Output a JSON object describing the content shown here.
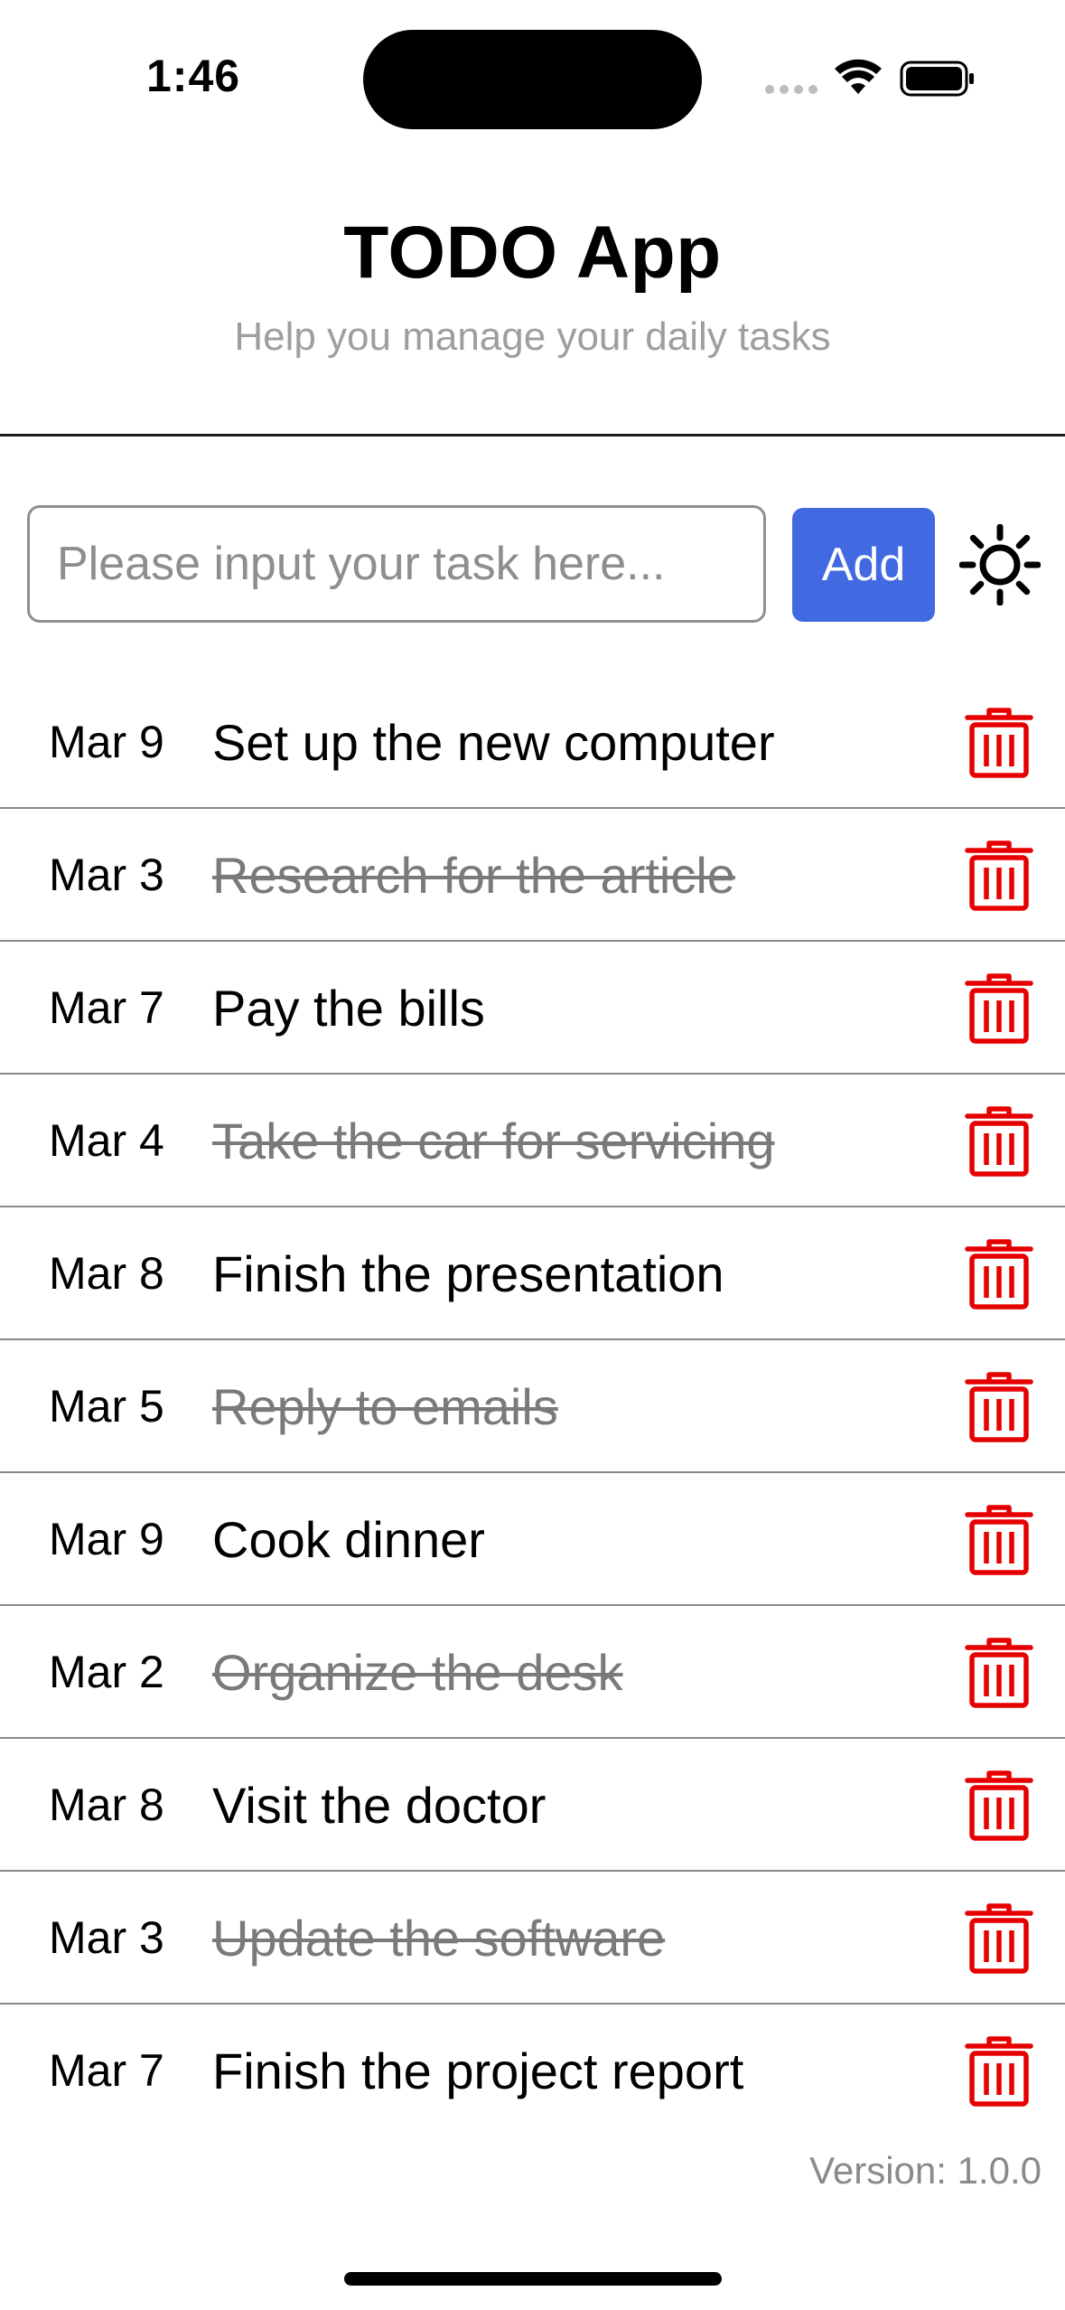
{
  "status_bar": {
    "time": "1:46"
  },
  "header": {
    "title": "TODO App",
    "subtitle": "Help you manage your daily tasks"
  },
  "input": {
    "placeholder": "Please input your task here...",
    "value": ""
  },
  "add_button": {
    "label": "Add"
  },
  "theme_toggle": {
    "icon": "sun-icon"
  },
  "tasks": [
    {
      "date": "Mar 9",
      "text": "Set up the new computer",
      "done": false
    },
    {
      "date": "Mar 3",
      "text": "Research for the article",
      "done": true
    },
    {
      "date": "Mar 7",
      "text": "Pay the bills",
      "done": false
    },
    {
      "date": "Mar 4",
      "text": "Take the car for servicing",
      "done": true
    },
    {
      "date": "Mar 8",
      "text": "Finish the presentation",
      "done": false
    },
    {
      "date": "Mar 5",
      "text": "Reply to emails",
      "done": true
    },
    {
      "date": "Mar 9",
      "text": "Cook dinner",
      "done": false
    },
    {
      "date": "Mar 2",
      "text": "Organize the desk",
      "done": true
    },
    {
      "date": "Mar 8",
      "text": "Visit the doctor",
      "done": false
    },
    {
      "date": "Mar 3",
      "text": "Update the software",
      "done": true
    },
    {
      "date": "Mar 7",
      "text": "Finish the project report",
      "done": false
    }
  ],
  "footer": {
    "version": "Version: 1.0.0"
  },
  "colors": {
    "accent": "#4169e1",
    "delete": "#e60000",
    "done_text": "#7a7a7a",
    "subtitle": "#9e9e9e"
  }
}
